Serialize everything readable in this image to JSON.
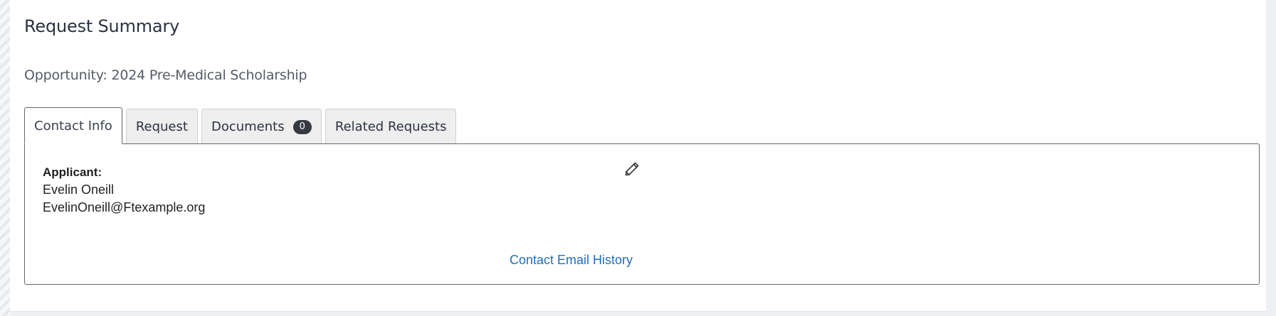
{
  "header": {
    "title": "Request Summary",
    "opportunity": "Opportunity: 2024 Pre-Medical Scholarship"
  },
  "tabs": [
    {
      "label": "Contact Info",
      "active": true
    },
    {
      "label": "Request",
      "active": false
    },
    {
      "label": "Documents",
      "active": false,
      "badge": "0"
    },
    {
      "label": "Related Requests",
      "active": false
    }
  ],
  "contact": {
    "applicant_label": "Applicant:",
    "name": "Evelin Oneill",
    "email": "EvelinOneill@Ftexample.org",
    "edit_icon": "pencil-icon",
    "history_link": "Contact Email History"
  },
  "colors": {
    "link": "#1f6fc0",
    "badge": "#343a40",
    "text": "#2b3240"
  }
}
